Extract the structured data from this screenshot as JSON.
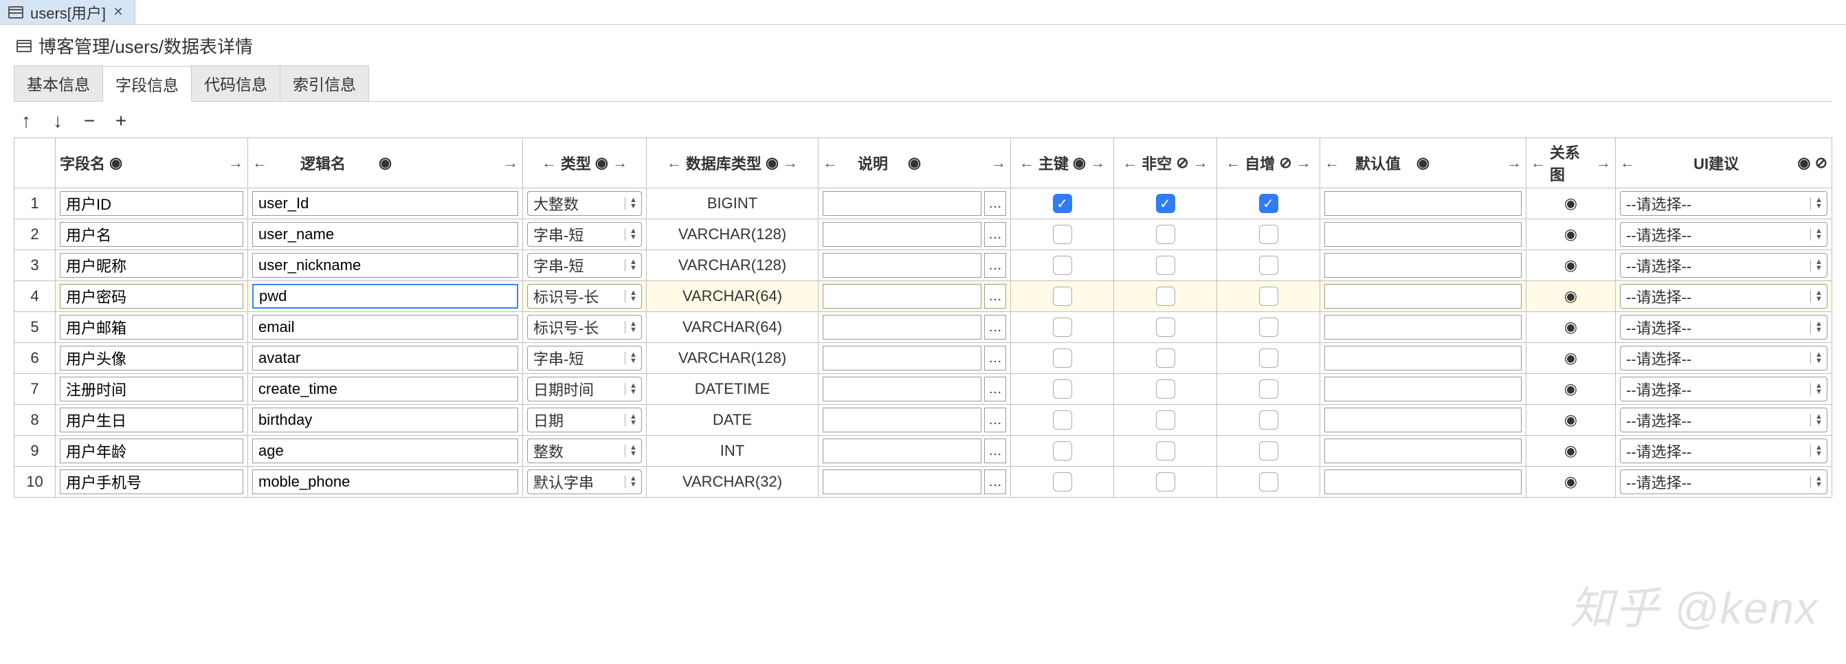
{
  "tab": {
    "title": "users[用户]"
  },
  "breadcrumb": "博客管理/users/数据表详情",
  "sub_tabs": {
    "basic": "基本信息",
    "fields": "字段信息",
    "code": "代码信息",
    "index": "索引信息",
    "active": "fields"
  },
  "toolbar": {
    "up": "↑",
    "down": "↓",
    "remove": "−",
    "add": "+"
  },
  "icons": {
    "arrow_left": "←",
    "arrow_right": "→",
    "eye": "◉",
    "eye_off": "⊘",
    "close": "✕",
    "check": "✓"
  },
  "headers": {
    "row": "",
    "field_name": "字段名",
    "logic_name": "逻辑名",
    "type": "类型",
    "db_type": "数据库类型",
    "desc": "说明",
    "pk": "主键",
    "notnull": "非空",
    "autoinc": "自增",
    "default": "默认值",
    "relation": "关系图",
    "ui": "UI建议"
  },
  "ui_placeholder": "--请选择--",
  "highlight_row": 4,
  "rows": [
    {
      "n": 1,
      "field": "用户ID",
      "logic": "user_Id",
      "type": "大整数",
      "db": "BIGINT",
      "pk": true,
      "nn": true,
      "ai": true
    },
    {
      "n": 2,
      "field": "用户名",
      "logic": "user_name",
      "type": "字串-短",
      "db": "VARCHAR(128)",
      "pk": false,
      "nn": false,
      "ai": false
    },
    {
      "n": 3,
      "field": "用户昵称",
      "logic": "user_nickname",
      "type": "字串-短",
      "db": "VARCHAR(128)",
      "pk": false,
      "nn": false,
      "ai": false
    },
    {
      "n": 4,
      "field": "用户密码",
      "logic": "pwd",
      "type": "标识号-长",
      "db": "VARCHAR(64)",
      "pk": false,
      "nn": false,
      "ai": false
    },
    {
      "n": 5,
      "field": "用户邮箱",
      "logic": "email",
      "type": "标识号-长",
      "db": "VARCHAR(64)",
      "pk": false,
      "nn": false,
      "ai": false
    },
    {
      "n": 6,
      "field": "用户头像",
      "logic": "avatar",
      "type": "字串-短",
      "db": "VARCHAR(128)",
      "pk": false,
      "nn": false,
      "ai": false
    },
    {
      "n": 7,
      "field": "注册时间",
      "logic": "create_time",
      "type": "日期时间",
      "db": "DATETIME",
      "pk": false,
      "nn": false,
      "ai": false
    },
    {
      "n": 8,
      "field": "用户生日",
      "logic": "birthday",
      "type": "日期",
      "db": "DATE",
      "pk": false,
      "nn": false,
      "ai": false
    },
    {
      "n": 9,
      "field": "用户年龄",
      "logic": "age",
      "type": "整数",
      "db": "INT",
      "pk": false,
      "nn": false,
      "ai": false
    },
    {
      "n": 10,
      "field": "用户手机号",
      "logic": "moble_phone",
      "type": "默认字串",
      "db": "VARCHAR(32)",
      "pk": false,
      "nn": false,
      "ai": false
    }
  ],
  "watermark": "知乎 @kenx"
}
